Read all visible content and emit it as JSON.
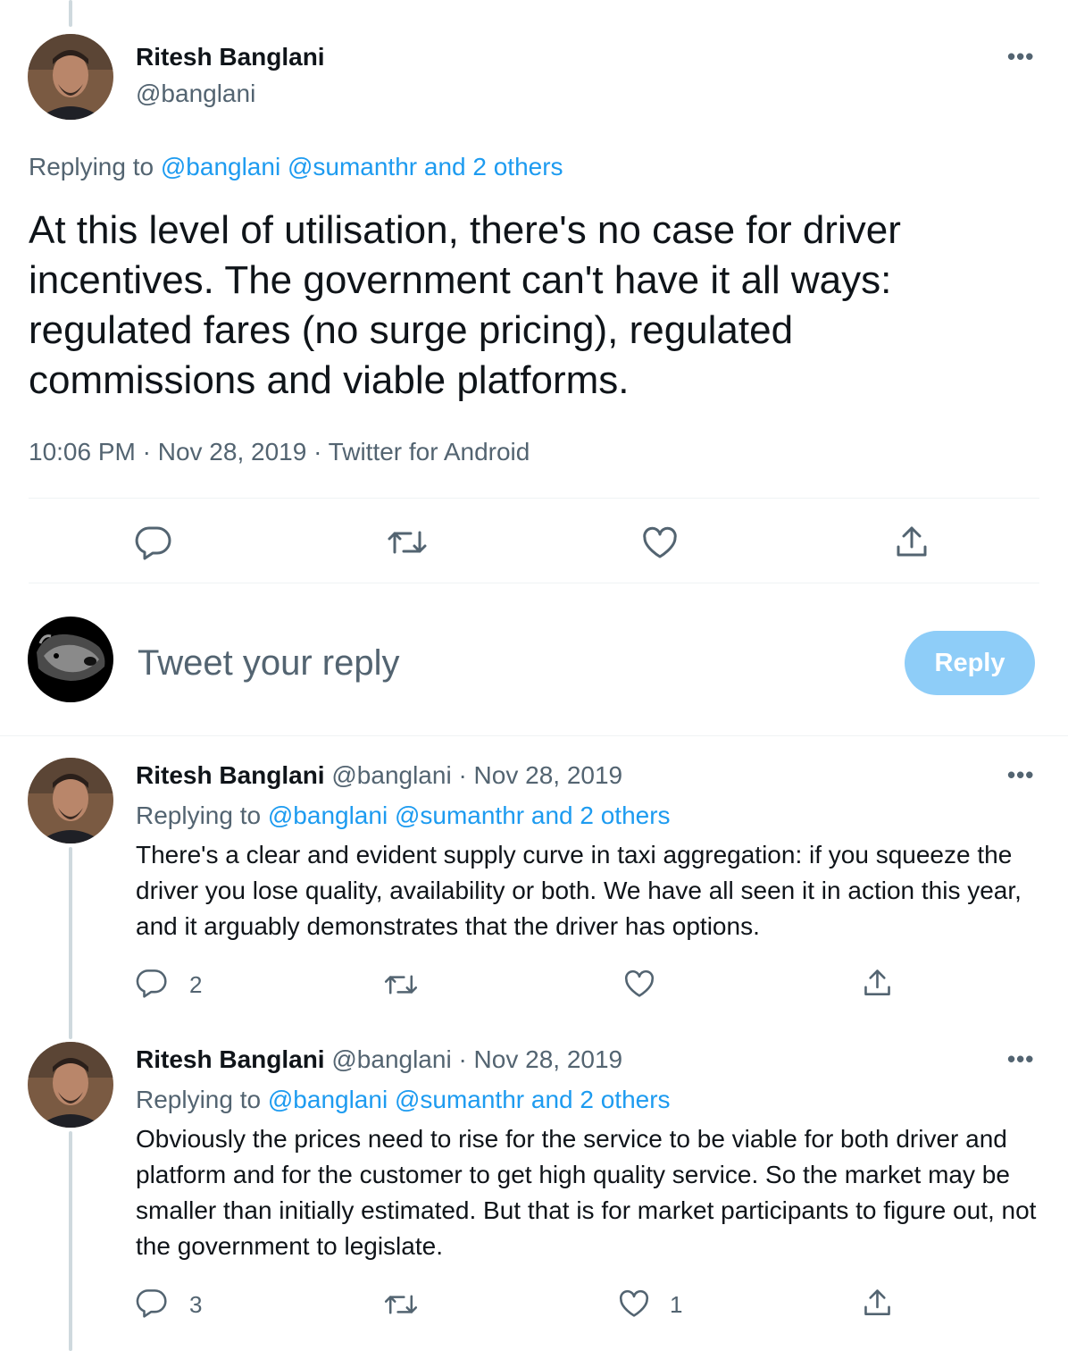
{
  "main_tweet": {
    "author_name": "Ritesh Banglani",
    "handle": "@banglani",
    "more_icon": "more-horizontal-icon",
    "replying_prefix": "Replying to",
    "replying_mentions": "@banglani @sumanthr and 2 others",
    "text": "At this level of utilisation, there's no case for driver incentives. The government can't have it all ways: regulated fares (no surge pricing), regulated commissions and viable platforms.",
    "meta": "10:06 PM · Nov 28, 2019 · Twitter for Android",
    "actions": [
      "reply-icon",
      "retweet-icon",
      "like-icon",
      "share-icon"
    ]
  },
  "compose": {
    "placeholder": "Tweet your reply",
    "reply_button": "Reply",
    "reply_button_color": "#8ecdf8"
  },
  "replies": [
    {
      "author_name": "Ritesh Banglani",
      "handle_date": "@banglani · Nov 28, 2019",
      "replying_prefix": "Replying to",
      "replying_mentions": "@banglani @sumanthr and 2 others",
      "text": "There's a clear and evident supply curve in taxi aggregation: if you squeeze the driver you lose quality, availability or both. We have all seen it in action this year, and it arguably demonstrates that the driver has options.",
      "reply_count": "2",
      "retweet_count": "",
      "like_count": ""
    },
    {
      "author_name": "Ritesh Banglani",
      "handle_date": "@banglani · Nov 28, 2019",
      "replying_prefix": "Replying to",
      "replying_mentions": "@banglani @sumanthr and 2 others",
      "text": "Obviously the prices need to rise for the service to be viable for both driver and platform and for the customer to get high quality service. So the market may be smaller than initially estimated. But that is for market participants to figure out, not the government to legislate.",
      "reply_count": "3",
      "retweet_count": "",
      "like_count": "1"
    }
  ],
  "colors": {
    "link": "#1d9bf0",
    "muted": "#536471",
    "divider": "#eff3f4",
    "thread_line": "#cfd9de"
  }
}
